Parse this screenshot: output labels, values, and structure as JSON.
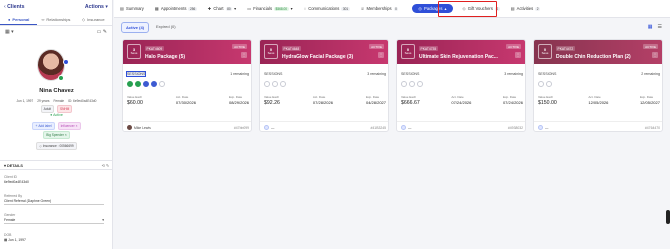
{
  "left": {
    "header_title": "Clients",
    "header_actions": "Actions",
    "tabs": [
      {
        "label": "Personal"
      },
      {
        "label": "Relationships"
      },
      {
        "label": "Insurance"
      }
    ],
    "client": {
      "name": "Nina Chavez",
      "dob": "Jun 1, 1997",
      "age": "29 years",
      "gender": "Female",
      "id": "ID: 6e9ed0a4E43d0",
      "tag_adult": "Adult",
      "tag_snhm": "SNHM",
      "status": "Active",
      "add_label": "Add label",
      "influencer": "Influencer",
      "big_spender": "Big Spender",
      "insurance": "Insurance : 00566699"
    },
    "details_title": "DETAILS",
    "fields": [
      {
        "label": "Client ID",
        "value": "6e9ed0a4E43d0"
      },
      {
        "label": "Referred By",
        "value": "Client Referral (Daphne Green)"
      },
      {
        "label": "Gender",
        "value": "Female"
      },
      {
        "label": "DOB",
        "value": "Jun 1, 1997"
      }
    ]
  },
  "nav": {
    "items": [
      {
        "label": "Summary",
        "badge": ""
      },
      {
        "label": "Appointments",
        "badge": "256"
      },
      {
        "label": "Chart",
        "badge": "80"
      },
      {
        "label": "Financials",
        "badge": "$568.00"
      },
      {
        "label": "Communications",
        "badge": "301"
      },
      {
        "label": "Memberships",
        "badge": "0"
      },
      {
        "label": "Packages",
        "badge": ""
      },
      {
        "label": "Gift Vouchers",
        "badge": "0"
      },
      {
        "label": "Activities",
        "badge": "2"
      }
    ]
  },
  "filters": [
    {
      "label": "Active (4)"
    },
    {
      "label": "Expired (0)"
    }
  ],
  "cards": [
    {
      "sessions_num": "3",
      "code": "PKAT4609",
      "title": "Halo Package (5)",
      "badge": "ACTIVE",
      "sessions_lbl": "SESSIONS",
      "remaining": "1 remaining",
      "vlabels": [
        "Value Each",
        "Act. Date",
        "Exp. Date"
      ],
      "vvalues": [
        "$60.00",
        "07/30/2026",
        "08/29/2026"
      ],
      "user": "Mike Lewis",
      "ref": "#47bb099"
    },
    {
      "sessions_num": "0",
      "code": "PKAT4648",
      "title": "HydraGlow Facial Package (3)",
      "badge": "ACTIVE",
      "sessions_lbl": "SESSIONS",
      "remaining": "3 remaining",
      "vlabels": [
        "Value Each",
        "Act. Date",
        "Exp. Date"
      ],
      "vvalues": [
        "$92.26",
        "07/28/2026",
        "04/28/2027"
      ],
      "user": "—",
      "ref": "#41B3245"
    },
    {
      "sessions_num": "0",
      "code": "PKAT4735",
      "title": "Ultimate Skin Rejuvenation Pac...",
      "badge": "ACTIVE",
      "sessions_lbl": "SESSIONS",
      "remaining": "3 remaining",
      "vlabels": [
        "Value Each",
        "Act. Date",
        "Exp. Date"
      ],
      "vvalues": [
        "$666.67",
        "07/24/2026",
        "07/24/2026"
      ],
      "user": "—",
      "ref": "#4938032"
    },
    {
      "sessions_num": "0",
      "code": "PKAT4472",
      "title": "Double Chin Reduction Plan (2)",
      "badge": "ACTIVE",
      "sessions_lbl": "SESSIONS",
      "remaining": "2 remaining",
      "vlabels": [
        "Value Each",
        "Act. Date",
        "Exp. Date"
      ],
      "vvalues": [
        "$150.00",
        "12/05/2026",
        "12/05/2027"
      ],
      "user": "—",
      "ref": "#4764470"
    }
  ],
  "colors": {
    "accent": "#2f4fd8",
    "card_header": "#b8336a",
    "highlight": "#e02020",
    "active": "#27a050"
  },
  "icons": {
    "sessions_box_label": "Sess"
  }
}
